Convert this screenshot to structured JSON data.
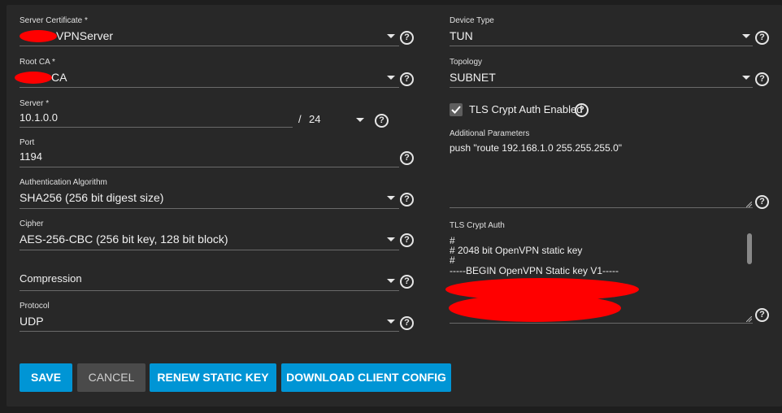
{
  "left": {
    "server_certificate": {
      "label": "Server Certificate *",
      "value": "VPNServer"
    },
    "root_ca": {
      "label": "Root CA *",
      "value": "CA"
    },
    "server": {
      "label": "Server *",
      "value": "10.1.0.0",
      "separator": "/",
      "netmask": "24"
    },
    "port": {
      "label": "Port",
      "value": "1194"
    },
    "auth_algorithm": {
      "label": "Authentication Algorithm",
      "value": "SHA256 (256 bit digest size)"
    },
    "cipher": {
      "label": "Cipher",
      "value": "AES-256-CBC (256 bit key, 128 bit block)"
    },
    "compression": {
      "label": "",
      "placeholder": "Compression"
    },
    "protocol": {
      "label": "Protocol",
      "value": "UDP"
    }
  },
  "right": {
    "device_type": {
      "label": "Device Type",
      "value": "TUN"
    },
    "topology": {
      "label": "Topology",
      "value": "SUBNET"
    },
    "tls_crypt_auth_enabled": {
      "label": "TLS Crypt Auth Enabled",
      "checked": true
    },
    "additional_parameters": {
      "label": "Additional Parameters",
      "value": "push \"route 192.168.1.0 255.255.255.0\""
    },
    "tls_crypt_auth": {
      "label": "TLS Crypt Auth",
      "lines": [
        "#",
        "# 2048 bit OpenVPN static key",
        "#",
        "-----BEGIN OpenVPN Static key V1-----"
      ]
    }
  },
  "buttons": {
    "save": "SAVE",
    "cancel": "CANCEL",
    "renew": "RENEW STATIC KEY",
    "download": "DOWNLOAD CLIENT CONFIG"
  },
  "help_glyph": "?",
  "colors": {
    "accent": "#0095d5",
    "redaction": "#ff0000",
    "background": "#282828"
  }
}
